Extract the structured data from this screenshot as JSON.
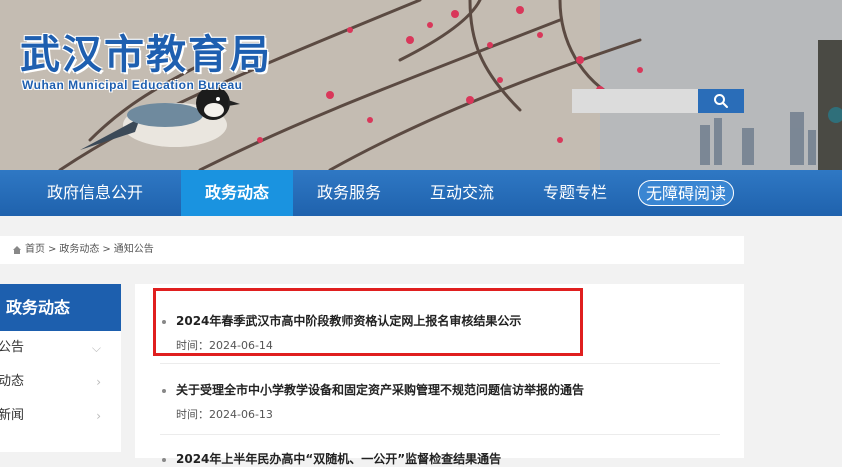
{
  "header": {
    "title": "武汉市教育局",
    "subtitle": "Wuhan Municipal Education Bureau",
    "search": {
      "placeholder": "",
      "icon": "search-icon"
    }
  },
  "nav": {
    "items": [
      {
        "label": "政府信息公开"
      },
      {
        "label": "政务动态",
        "active": true
      },
      {
        "label": "政务服务"
      },
      {
        "label": "互动交流"
      },
      {
        "label": "专题专栏"
      }
    ],
    "accessibility_label": "无障碍阅读"
  },
  "breadcrumb": {
    "home": "首页",
    "separator": ">",
    "level1": "政务动态",
    "level2": "通知公告"
  },
  "sidebar": {
    "heading": "政务动态",
    "items": [
      {
        "label": "公告"
      },
      {
        "label": "动态"
      },
      {
        "label": "新闻"
      }
    ]
  },
  "news": [
    {
      "title": "2024年春季武汉市高中阶段教师资格认定网上报名审核结果公示",
      "date_prefix": "时间：",
      "date": "2024-06-14"
    },
    {
      "title": "关于受理全市中小学教学设备和固定资产采购管理不规范问题信访举报的通告",
      "date_prefix": "时间：",
      "date": "2024-06-13"
    },
    {
      "title": "2024年上半年民办高中“双随机、一公开”监督检查结果通告"
    }
  ],
  "colors": {
    "brand": "#1e5fb0",
    "nav": "#2a6db8",
    "nav_active": "#1a93e0",
    "highlight": "#e01f1f"
  }
}
